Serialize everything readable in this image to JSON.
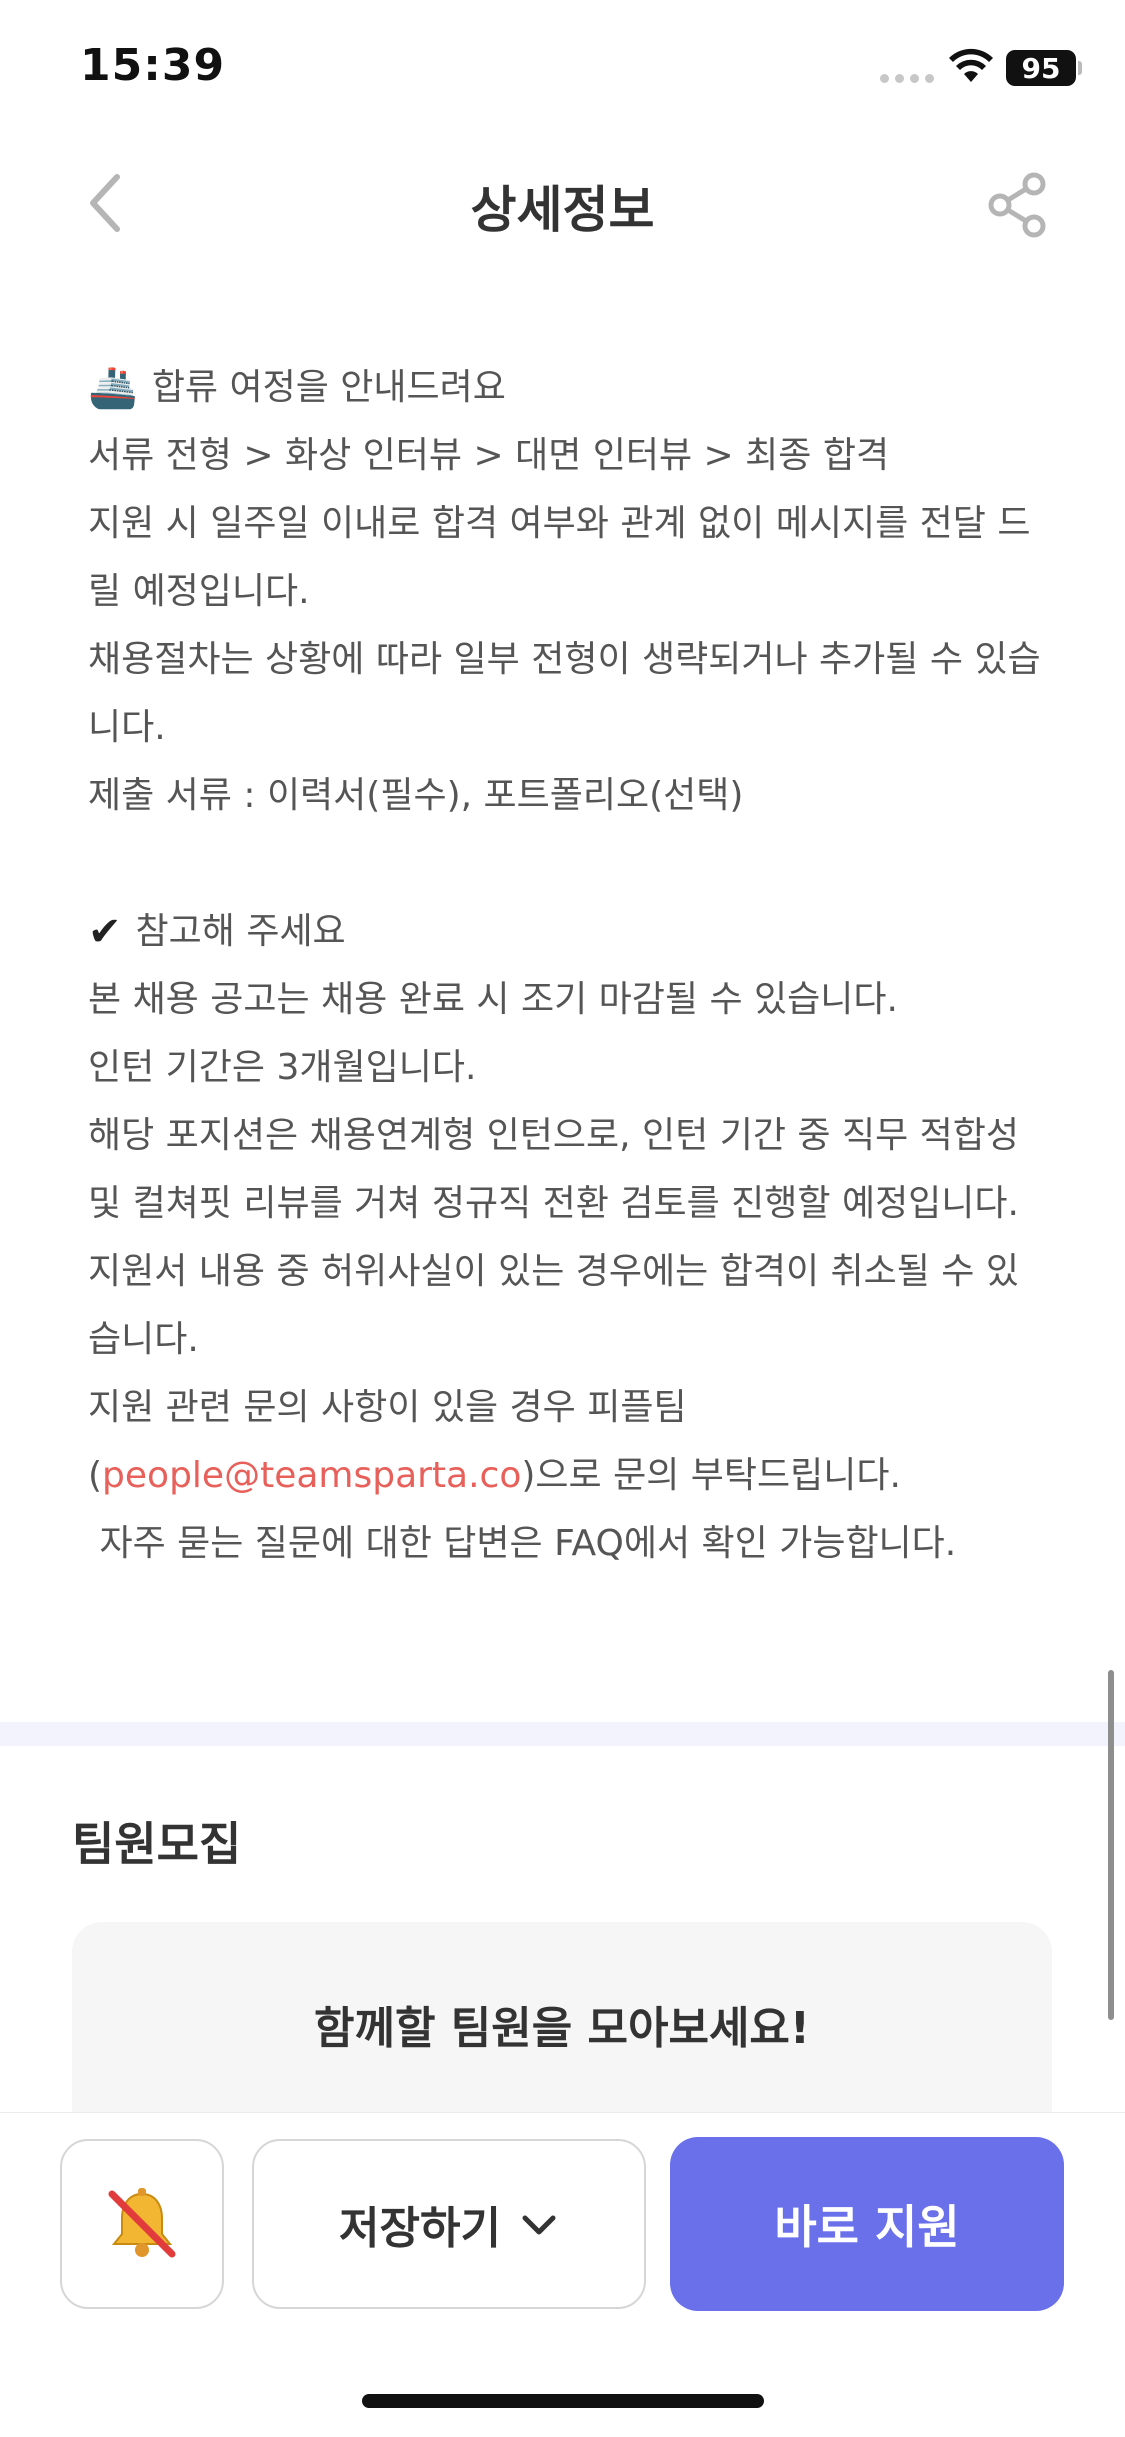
{
  "status_bar": {
    "time": "15:39",
    "battery": "95"
  },
  "header": {
    "title": "상세정보",
    "back_icon": "chevron-left-icon",
    "share_icon": "share-icon"
  },
  "process_section": {
    "emoji": "🚢",
    "heading": "합류 여정을 안내드려요",
    "lines": [
      "서류 전형 > 화상 인터뷰 > 대면 인터뷰 > 최종 합격",
      "지원 시 일주일 이내로 합격 여부와 관계 없이 메시지를 전달 드릴 예정입니다.",
      "채용절차는 상황에 따라 일부 전형이 생략되거나 추가될 수 있습니다.",
      "제출 서류 : 이력서(필수), 포트폴리오(선택)"
    ]
  },
  "notes_section": {
    "emoji": "✔",
    "heading": "참고해 주세요",
    "lines": [
      "본 채용 공고는 채용 완료 시 조기 마감될 수 있습니다.",
      "인턴 기간은 3개월입니다.",
      "해당 포지션은 채용연계형 인턴으로, 인턴 기간 중 직무 적합성 및 컬쳐핏 리뷰를 거쳐 정규직 전환 검토를 진행할 예정입니다.",
      "지원서 내용 중 허위사실이 있는 경우에는 합격이 취소될 수 있습니다.",
      "지원 관련 문의 사항이 있을 경우 피플팀"
    ],
    "contact_prefix": "(",
    "contact_email": "people@teamsparta.co",
    "contact_suffix": ")으로 문의 부탁드립니다.",
    "faq_line": " 자주 묻는 질문에 대한 답변은 FAQ에서 확인 가능합니다."
  },
  "team_recruit": {
    "title": "팀원모집",
    "card_text": "함께할 팀원을 모아보세요!"
  },
  "bottom_bar": {
    "alarm_icon": "bell-off-icon",
    "save_label": "저장하기",
    "apply_label": "바로 지원"
  },
  "colors": {
    "accent": "#6a6fea",
    "link": "#e8605a"
  }
}
